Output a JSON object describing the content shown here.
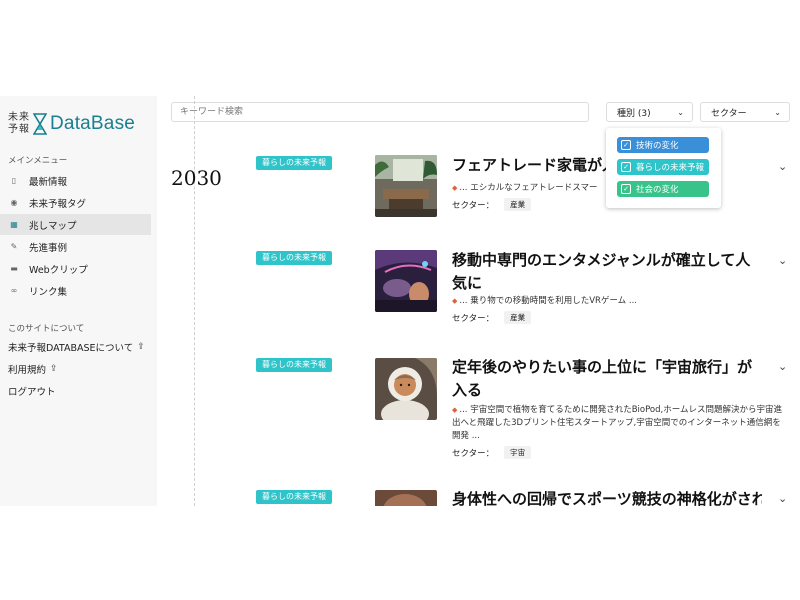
{
  "logo": {
    "kanji_line1": "未来",
    "kanji_line2": "予報",
    "text": "DataBase"
  },
  "sidebar": {
    "main_title": "メインメニュー",
    "items": [
      {
        "label": "最新情報",
        "icon": "news-icon"
      },
      {
        "label": "未来予報タグ",
        "icon": "eye-icon"
      },
      {
        "label": "兆しマップ",
        "icon": "map-icon",
        "active": true
      },
      {
        "label": "先進事例",
        "icon": "pen-icon"
      },
      {
        "label": "Webクリップ",
        "icon": "clip-icon"
      },
      {
        "label": "リンク集",
        "icon": "link-icon"
      }
    ],
    "about_title": "このサイトについて",
    "about_items": [
      {
        "label": "未来予報DATABASEについて"
      },
      {
        "label": "利用規約"
      },
      {
        "label": "ログアウト"
      }
    ]
  },
  "search": {
    "placeholder": "キーワード検索"
  },
  "filters": {
    "category_label": "種別 (3)",
    "sector_label": "セクター",
    "options": [
      {
        "label": "技術の変化",
        "color": "#3a8fd9",
        "checked": true
      },
      {
        "label": "暮らしの未来予報",
        "color": "#2ec4c9",
        "checked": true
      },
      {
        "label": "社会の変化",
        "color": "#38c38a",
        "checked": true
      }
    ]
  },
  "timeline": {
    "year": "2030"
  },
  "cards": [
    {
      "tag": "暮らしの未来予報",
      "title": "フェアトレード家電が人",
      "excerpt": "... エシカルなフェアトレードスマー",
      "sector_label": "セクター：",
      "sector": "産業"
    },
    {
      "tag": "暮らしの未来予報",
      "title": "移動中専門のエンタメジャンルが確立して人気に",
      "excerpt": "... 乗り物での移動時間を利用したVRゲーム ...",
      "sector_label": "セクター：",
      "sector": "産業"
    },
    {
      "tag": "暮らしの未来予報",
      "title": "定年後のやりたい事の上位に「宇宙旅行」が入る",
      "excerpt": "... 宇宙空間で植物を育てるために開発されたBioPod,ホームレス問題解決から宇宙進出へと飛躍した3Dプリント住宅スタートアップ,宇宙空間でのインターネット通信網を開発 ...",
      "sector_label": "セクター：",
      "sector": "宇宙"
    },
    {
      "tag": "暮らしの未来予報",
      "title": "身体性への回帰でスポーツ競技の神格化がされ"
    }
  ],
  "colors": {
    "accent": "#2ec4c9",
    "brand": "#1a7f8e",
    "sidebar_bg": "#f7f7f7"
  }
}
